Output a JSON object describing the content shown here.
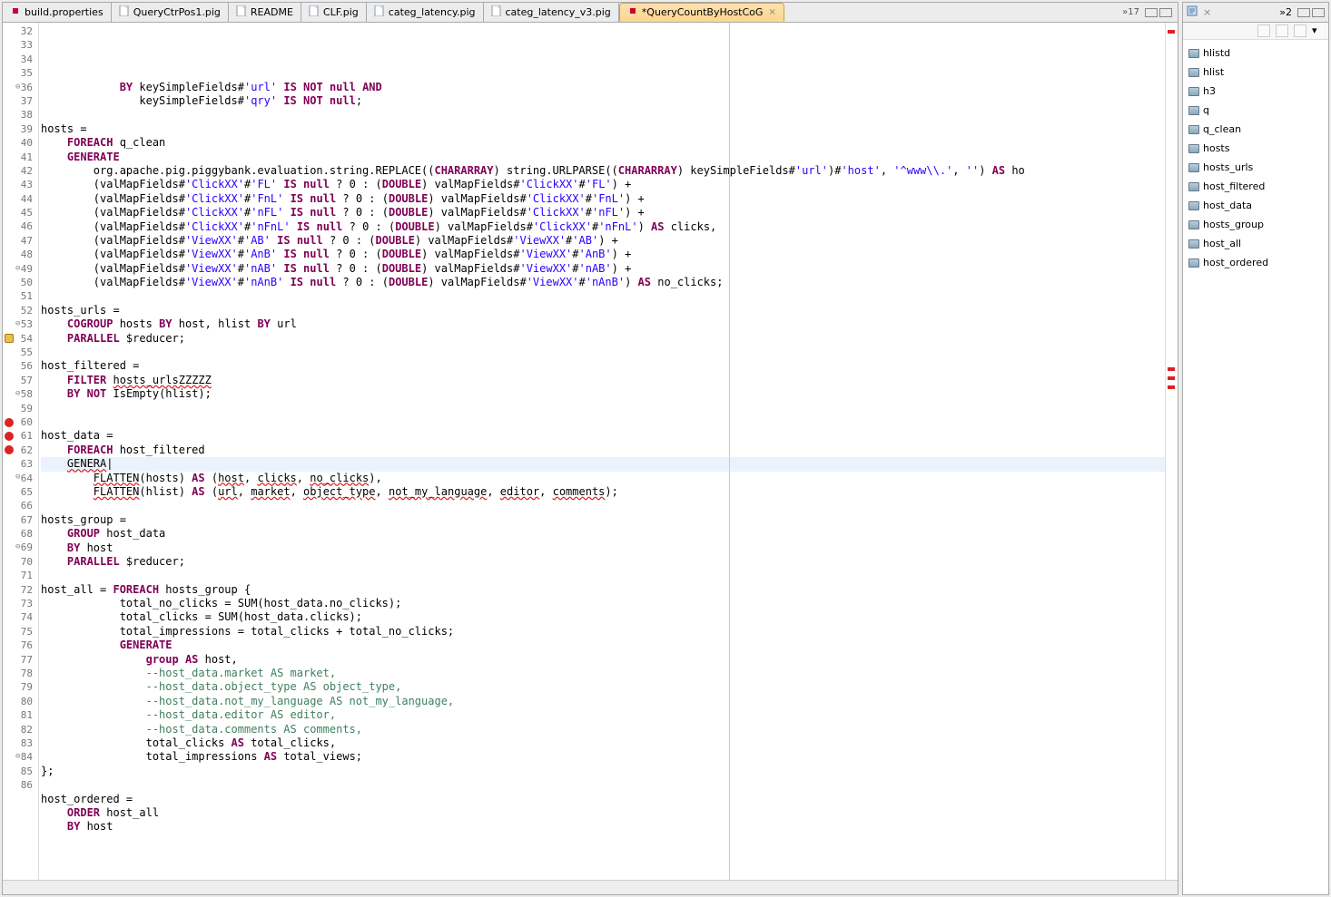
{
  "tabs": [
    {
      "label": "build.properties",
      "dirty": true,
      "active": false
    },
    {
      "label": "QueryCtrPos1.pig",
      "dirty": false,
      "active": false
    },
    {
      "label": "README",
      "dirty": false,
      "active": false
    },
    {
      "label": "CLF.pig",
      "dirty": false,
      "active": false
    },
    {
      "label": "categ_latency.pig",
      "dirty": false,
      "active": false
    },
    {
      "label": "categ_latency_v3.pig",
      "dirty": false,
      "active": false
    },
    {
      "label": "*QueryCountByHostCoG",
      "dirty": true,
      "active": true
    }
  ],
  "tab_overflow": "»17",
  "outline_tab_overflow": "»2",
  "outline_tab_icon_title": "Outline",
  "outline": [
    "hlistd",
    "hlist",
    "h3",
    "q",
    "q_clean",
    "hosts",
    "hosts_urls",
    "host_filtered",
    "host_data",
    "hosts_group",
    "host_all",
    "host_ordered"
  ],
  "code": {
    "start": 32,
    "markers": {
      "54": "warn",
      "60": "err",
      "61": "err",
      "62": "err"
    },
    "folds": [
      36,
      49,
      53,
      58,
      64,
      69,
      84
    ],
    "highlight": [
      60
    ],
    "lines": [
      [
        [
          "",
          ""
        ]
      ],
      [
        [
          "            ",
          ""
        ],
        [
          "BY",
          "k"
        ],
        [
          " keySimpleFields#",
          ""
        ],
        [
          "'url'",
          "s"
        ],
        [
          " ",
          ""
        ],
        [
          "IS NOT",
          "k"
        ],
        [
          " ",
          ""
        ],
        [
          "null",
          "k"
        ],
        [
          " ",
          ""
        ],
        [
          "AND",
          "k"
        ]
      ],
      [
        [
          "               keySimpleFields#",
          ""
        ],
        [
          "'qry'",
          "s"
        ],
        [
          " ",
          ""
        ],
        [
          "IS NOT",
          "k"
        ],
        [
          " ",
          ""
        ],
        [
          "null",
          "k"
        ],
        [
          ";",
          ""
        ]
      ],
      [
        [
          "",
          ""
        ]
      ],
      [
        [
          "hosts =",
          ""
        ]
      ],
      [
        [
          "    ",
          ""
        ],
        [
          "FOREACH",
          "k"
        ],
        [
          " q_clean",
          ""
        ]
      ],
      [
        [
          "    ",
          ""
        ],
        [
          "GENERATE",
          "k"
        ]
      ],
      [
        [
          "        org.apache.pig.piggybank.evaluation.string.REPLACE((",
          ""
        ],
        [
          "CHARARRAY",
          "k"
        ],
        [
          ") string.URLPARSE((",
          ""
        ],
        [
          "CHARARRAY",
          "k"
        ],
        [
          ") keySimpleFields#",
          ""
        ],
        [
          "'url'",
          "s"
        ],
        [
          ")#",
          ""
        ],
        [
          "'host'",
          "s"
        ],
        [
          ", ",
          ""
        ],
        [
          "'^www\\\\.'",
          "s"
        ],
        [
          ", ",
          ""
        ],
        [
          "''",
          "s"
        ],
        [
          ") ",
          ""
        ],
        [
          "AS",
          "k"
        ],
        [
          " ho",
          ""
        ]
      ],
      [
        [
          "        (valMapFields#",
          ""
        ],
        [
          "'ClickXX'",
          "s"
        ],
        [
          "#",
          ""
        ],
        [
          "'FL'",
          "s"
        ],
        [
          " ",
          ""
        ],
        [
          "IS",
          "k"
        ],
        [
          " ",
          ""
        ],
        [
          "null",
          "k"
        ],
        [
          " ? 0 : (",
          ""
        ],
        [
          "DOUBLE",
          "k"
        ],
        [
          ") valMapFields#",
          ""
        ],
        [
          "'ClickXX'",
          "s"
        ],
        [
          "#",
          ""
        ],
        [
          "'FL'",
          "s"
        ],
        [
          ") +",
          ""
        ]
      ],
      [
        [
          "        (valMapFields#",
          ""
        ],
        [
          "'ClickXX'",
          "s"
        ],
        [
          "#",
          ""
        ],
        [
          "'FnL'",
          "s"
        ],
        [
          " ",
          ""
        ],
        [
          "IS",
          "k"
        ],
        [
          " ",
          ""
        ],
        [
          "null",
          "k"
        ],
        [
          " ? 0 : (",
          ""
        ],
        [
          "DOUBLE",
          "k"
        ],
        [
          ") valMapFields#",
          ""
        ],
        [
          "'ClickXX'",
          "s"
        ],
        [
          "#",
          ""
        ],
        [
          "'FnL'",
          "s"
        ],
        [
          ") +",
          ""
        ]
      ],
      [
        [
          "        (valMapFields#",
          ""
        ],
        [
          "'ClickXX'",
          "s"
        ],
        [
          "#",
          ""
        ],
        [
          "'nFL'",
          "s"
        ],
        [
          " ",
          ""
        ],
        [
          "IS",
          "k"
        ],
        [
          " ",
          ""
        ],
        [
          "null",
          "k"
        ],
        [
          " ? 0 : (",
          ""
        ],
        [
          "DOUBLE",
          "k"
        ],
        [
          ") valMapFields#",
          ""
        ],
        [
          "'ClickXX'",
          "s"
        ],
        [
          "#",
          ""
        ],
        [
          "'nFL'",
          "s"
        ],
        [
          ") +",
          ""
        ]
      ],
      [
        [
          "        (valMapFields#",
          ""
        ],
        [
          "'ClickXX'",
          "s"
        ],
        [
          "#",
          ""
        ],
        [
          "'nFnL'",
          "s"
        ],
        [
          " ",
          ""
        ],
        [
          "IS",
          "k"
        ],
        [
          " ",
          ""
        ],
        [
          "null",
          "k"
        ],
        [
          " ? 0 : (",
          ""
        ],
        [
          "DOUBLE",
          "k"
        ],
        [
          ") valMapFields#",
          ""
        ],
        [
          "'ClickXX'",
          "s"
        ],
        [
          "#",
          ""
        ],
        [
          "'nFnL'",
          "s"
        ],
        [
          ") ",
          ""
        ],
        [
          "AS",
          "k"
        ],
        [
          " clicks,",
          ""
        ]
      ],
      [
        [
          "        (valMapFields#",
          ""
        ],
        [
          "'ViewXX'",
          "s"
        ],
        [
          "#",
          ""
        ],
        [
          "'AB'",
          "s"
        ],
        [
          " ",
          ""
        ],
        [
          "IS",
          "k"
        ],
        [
          " ",
          ""
        ],
        [
          "null",
          "k"
        ],
        [
          " ? 0 : (",
          ""
        ],
        [
          "DOUBLE",
          "k"
        ],
        [
          ") valMapFields#",
          ""
        ],
        [
          "'ViewXX'",
          "s"
        ],
        [
          "#",
          ""
        ],
        [
          "'AB'",
          "s"
        ],
        [
          ") +",
          ""
        ]
      ],
      [
        [
          "        (valMapFields#",
          ""
        ],
        [
          "'ViewXX'",
          "s"
        ],
        [
          "#",
          ""
        ],
        [
          "'AnB'",
          "s"
        ],
        [
          " ",
          ""
        ],
        [
          "IS",
          "k"
        ],
        [
          " ",
          ""
        ],
        [
          "null",
          "k"
        ],
        [
          " ? 0 : (",
          ""
        ],
        [
          "DOUBLE",
          "k"
        ],
        [
          ") valMapFields#",
          ""
        ],
        [
          "'ViewXX'",
          "s"
        ],
        [
          "#",
          ""
        ],
        [
          "'AnB'",
          "s"
        ],
        [
          ") +",
          ""
        ]
      ],
      [
        [
          "        (valMapFields#",
          ""
        ],
        [
          "'ViewXX'",
          "s"
        ],
        [
          "#",
          ""
        ],
        [
          "'nAB'",
          "s"
        ],
        [
          " ",
          ""
        ],
        [
          "IS",
          "k"
        ],
        [
          " ",
          ""
        ],
        [
          "null",
          "k"
        ],
        [
          " ? 0 : (",
          ""
        ],
        [
          "DOUBLE",
          "k"
        ],
        [
          ") valMapFields#",
          ""
        ],
        [
          "'ViewXX'",
          "s"
        ],
        [
          "#",
          ""
        ],
        [
          "'nAB'",
          "s"
        ],
        [
          ") +",
          ""
        ]
      ],
      [
        [
          "        (valMapFields#",
          ""
        ],
        [
          "'ViewXX'",
          "s"
        ],
        [
          "#",
          ""
        ],
        [
          "'nAnB'",
          "s"
        ],
        [
          " ",
          ""
        ],
        [
          "IS",
          "k"
        ],
        [
          " ",
          ""
        ],
        [
          "null",
          "k"
        ],
        [
          " ? 0 : (",
          ""
        ],
        [
          "DOUBLE",
          "k"
        ],
        [
          ") valMapFields#",
          ""
        ],
        [
          "'ViewXX'",
          "s"
        ],
        [
          "#",
          ""
        ],
        [
          "'nAnB'",
          "s"
        ],
        [
          ") ",
          ""
        ],
        [
          "AS",
          "k"
        ],
        [
          " no_clicks;",
          ""
        ]
      ],
      [
        [
          "",
          ""
        ]
      ],
      [
        [
          "hosts_urls =",
          ""
        ]
      ],
      [
        [
          "    ",
          ""
        ],
        [
          "COGROUP",
          "k"
        ],
        [
          " hosts ",
          ""
        ],
        [
          "BY",
          "k"
        ],
        [
          " host, hlist ",
          ""
        ],
        [
          "BY",
          "k"
        ],
        [
          " url",
          ""
        ]
      ],
      [
        [
          "    ",
          ""
        ],
        [
          "PARALLEL",
          "k"
        ],
        [
          " $reducer;",
          ""
        ]
      ],
      [
        [
          "",
          ""
        ]
      ],
      [
        [
          "host_filtered =",
          ""
        ]
      ],
      [
        [
          "    ",
          ""
        ],
        [
          "FILTER",
          "k"
        ],
        [
          " ",
          ""
        ],
        [
          "hosts_urlsZZZZZ",
          "err-u"
        ]
      ],
      [
        [
          "    ",
          ""
        ],
        [
          "BY",
          "k"
        ],
        [
          " ",
          ""
        ],
        [
          "NOT",
          "k"
        ],
        [
          " IsEmpty(hlist);",
          ""
        ]
      ],
      [
        [
          "",
          ""
        ]
      ],
      [
        [
          "",
          ""
        ]
      ],
      [
        [
          "host_data =",
          ""
        ]
      ],
      [
        [
          "    ",
          ""
        ],
        [
          "FOREACH",
          "k"
        ],
        [
          " host_filtered",
          ""
        ]
      ],
      [
        [
          "    ",
          ""
        ],
        [
          "GENERA",
          "err-u"
        ],
        [
          "|",
          ""
        ]
      ],
      [
        [
          "        ",
          ""
        ],
        [
          "FLATTEN",
          "err-u"
        ],
        [
          "(hosts) ",
          ""
        ],
        [
          "AS",
          "k"
        ],
        [
          " (",
          ""
        ],
        [
          "host",
          "err-u"
        ],
        [
          ", ",
          ""
        ],
        [
          "clicks",
          "err-u"
        ],
        [
          ", ",
          ""
        ],
        [
          "no_clicks",
          "err-u"
        ],
        [
          "),",
          ""
        ]
      ],
      [
        [
          "        ",
          ""
        ],
        [
          "FLATTEN",
          "err-u"
        ],
        [
          "(hlist) ",
          ""
        ],
        [
          "AS",
          "k"
        ],
        [
          " (",
          ""
        ],
        [
          "url",
          "err-u"
        ],
        [
          ", ",
          ""
        ],
        [
          "market",
          "err-u"
        ],
        [
          ", ",
          ""
        ],
        [
          "object_type",
          "err-u"
        ],
        [
          ", ",
          ""
        ],
        [
          "not_my_language",
          "err-u"
        ],
        [
          ", ",
          ""
        ],
        [
          "editor",
          "err-u"
        ],
        [
          ", ",
          ""
        ],
        [
          "comments",
          "err-u"
        ],
        [
          ");",
          ""
        ]
      ],
      [
        [
          "",
          ""
        ]
      ],
      [
        [
          "hosts_group =",
          ""
        ]
      ],
      [
        [
          "    ",
          ""
        ],
        [
          "GROUP",
          "k"
        ],
        [
          " host_data",
          ""
        ]
      ],
      [
        [
          "    ",
          ""
        ],
        [
          "BY",
          "k"
        ],
        [
          " host",
          ""
        ]
      ],
      [
        [
          "    ",
          ""
        ],
        [
          "PARALLEL",
          "k"
        ],
        [
          " $reducer;",
          ""
        ]
      ],
      [
        [
          "",
          ""
        ]
      ],
      [
        [
          "host_all = ",
          ""
        ],
        [
          "FOREACH",
          "k"
        ],
        [
          " hosts_group {",
          ""
        ]
      ],
      [
        [
          "            total_no_clicks = SUM(host_data.no_clicks);",
          ""
        ]
      ],
      [
        [
          "            total_clicks = SUM(host_data.clicks);",
          ""
        ]
      ],
      [
        [
          "            total_impressions = total_clicks + total_no_clicks;",
          ""
        ]
      ],
      [
        [
          "            ",
          ""
        ],
        [
          "GENERATE",
          "k"
        ]
      ],
      [
        [
          "                ",
          ""
        ],
        [
          "group",
          "k"
        ],
        [
          " ",
          ""
        ],
        [
          "AS",
          "k"
        ],
        [
          " host,",
          ""
        ]
      ],
      [
        [
          "                ",
          ""
        ],
        [
          "--host_data.market AS market,",
          "c"
        ]
      ],
      [
        [
          "                ",
          ""
        ],
        [
          "--host_data.object_type AS object_type,",
          "c"
        ]
      ],
      [
        [
          "                ",
          ""
        ],
        [
          "--host_data.not_my_language AS not_my_language,",
          "c"
        ]
      ],
      [
        [
          "                ",
          ""
        ],
        [
          "--host_data.editor AS editor,",
          "c"
        ]
      ],
      [
        [
          "                ",
          ""
        ],
        [
          "--host_data.comments AS comments,",
          "c"
        ]
      ],
      [
        [
          "                total_clicks ",
          ""
        ],
        [
          "AS",
          "k"
        ],
        [
          " total_clicks,",
          ""
        ]
      ],
      [
        [
          "                total_impressions ",
          ""
        ],
        [
          "AS",
          "k"
        ],
        [
          " total_views;",
          ""
        ]
      ],
      [
        [
          "};",
          ""
        ]
      ],
      [
        [
          "",
          ""
        ]
      ],
      [
        [
          "host_ordered =",
          ""
        ]
      ],
      [
        [
          "    ",
          ""
        ],
        [
          "ORDER",
          "k"
        ],
        [
          " host_all",
          ""
        ]
      ],
      [
        [
          "    ",
          ""
        ],
        [
          "BY",
          "k"
        ],
        [
          " host",
          ""
        ]
      ]
    ]
  }
}
